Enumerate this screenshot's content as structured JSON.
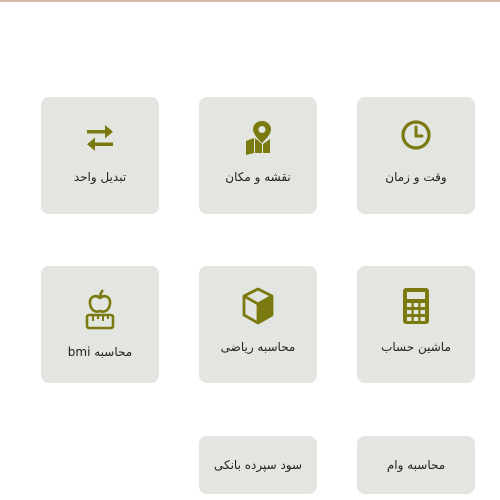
{
  "colors": {
    "card_bg": "#e3e6e0",
    "icon": "#7a7a10",
    "text": "#222222",
    "top_line": "#d8b9a8"
  },
  "tiles": [
    {
      "label": "تبدیل واحد",
      "icon": "swap-arrows-icon"
    },
    {
      "label": "نقشه و مکان",
      "icon": "map-pin-icon"
    },
    {
      "label": "وقت و زمان",
      "icon": "clock-icon"
    },
    {
      "label": "محاسبه bmi",
      "icon": "apple-scale-icon"
    },
    {
      "label": "محاسبه ریاضی",
      "icon": "cube-icon"
    },
    {
      "label": "ماشین حساب",
      "icon": "calculator-icon"
    },
    {
      "label": "سود سپرده بانکی",
      "icon": ""
    },
    {
      "label": "محاسبه وام",
      "icon": ""
    }
  ]
}
